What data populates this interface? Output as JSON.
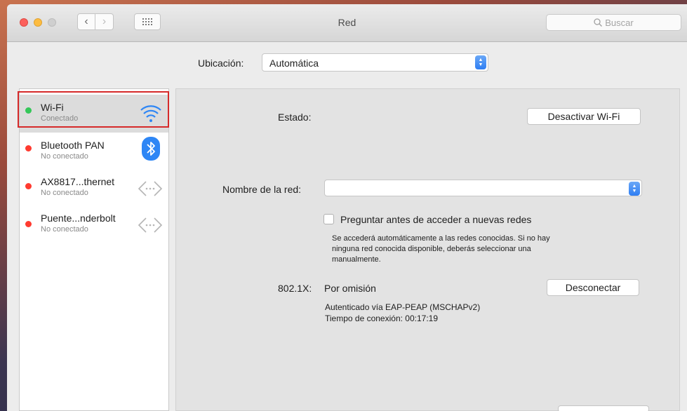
{
  "window": {
    "title": "Red",
    "search_placeholder": "Buscar"
  },
  "location": {
    "label": "Ubicación:",
    "value": "Automática"
  },
  "services": [
    {
      "name": "Wi-Fi",
      "status": "Conectado",
      "status_color": "#34c759",
      "icon": "wifi-icon",
      "selected": true
    },
    {
      "name": "Bluetooth PAN",
      "status": "No conectado",
      "status_color": "#ff3b30",
      "icon": "bluetooth-icon",
      "selected": false
    },
    {
      "name": "AX8817...thernet",
      "status": "No conectado",
      "status_color": "#ff3b30",
      "icon": "ethernet-icon",
      "selected": false
    },
    {
      "name": "Puente...nderbolt",
      "status": "No conectado",
      "status_color": "#ff3b30",
      "icon": "ethernet-icon",
      "selected": false
    }
  ],
  "detail": {
    "status_label": "Estado:",
    "toggle_wifi_button": "Desactivar Wi-Fi",
    "network_name_label": "Nombre de la red:",
    "network_name_value": "",
    "ask_checkbox_label": "Preguntar antes de acceder a nuevas redes",
    "ask_checkbox_checked": false,
    "ask_help_line1": "Se accederá automáticamente a las redes conocidas. Si no hay",
    "ask_help_line2": "ninguna red conocida disponible, deberás seleccionar una",
    "ask_help_line3": "manualmente.",
    "dot1x_label": "802.1X:",
    "dot1x_value": "Por omisión",
    "disconnect_button": "Desconectar",
    "auth_info": "Autenticado vía EAP-PEAP (MSCHAPv2)",
    "connection_time": "Tiempo de conexión: 00:17:19"
  },
  "colors": {
    "accent": "#2e7ef3",
    "highlight_border": "#d62a2a"
  }
}
